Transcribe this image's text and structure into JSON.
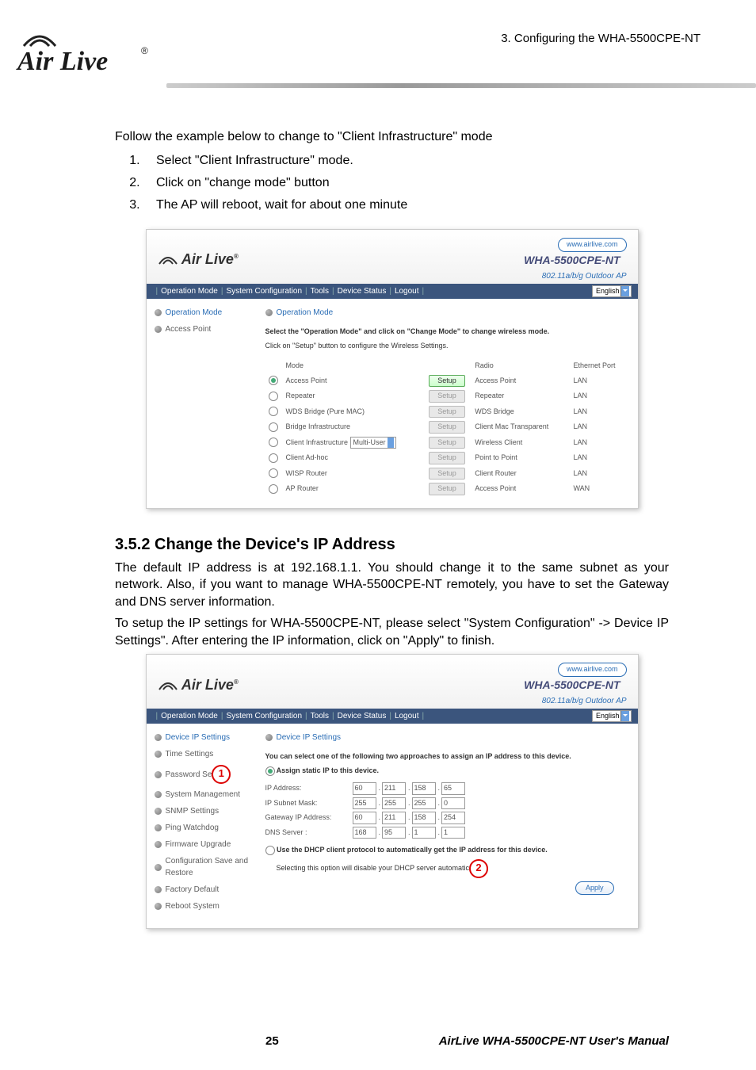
{
  "doc": {
    "chapter_title": "3. Configuring the WHA-5500CPE-NT",
    "brand": "Air Live",
    "intro": "Follow the example below to change to \"Client Infrastructure\" mode",
    "steps": [
      "Select \"Client Infrastructure\" mode.",
      "Click on \"change mode\" button",
      "The AP will reboot, wait for about one minute"
    ],
    "section_heading": "3.5.2 Change the Device's IP Address",
    "ip_para1": "The default IP address is at 192.168.1.1.   You should change it to the same subnet as your network.   Also, if you want to manage WHA-5500CPE-NT remotely, you have to set the Gateway and DNS server information.",
    "ip_para2": "To setup the IP settings for WHA-5500CPE-NT, please select \"System Configuration\" -> Device IP Settings\".   After entering the IP information, click on \"Apply\" to finish.",
    "page_number": "25",
    "footer_right": "AirLive WHA-5500CPE-NT User's Manual"
  },
  "shot1": {
    "url": "www.airlive.com",
    "model": "WHA-5500CPE-NT",
    "subtitle": "802.11a/b/g Outdoor AP",
    "nav": [
      "Operation Mode",
      "System Configuration",
      "Tools",
      "Device Status",
      "Logout"
    ],
    "lang_selected": "English",
    "sidebar": [
      {
        "label": "Operation Mode",
        "active": true
      },
      {
        "label": "Access Point",
        "active": false
      }
    ],
    "panel_title": "Operation Mode",
    "instr_bold": "Select the \"Operation Mode\" and click on \"Change Mode\" to change wireless mode.",
    "instr": "Click on \"Setup\" button to configure the Wireless Settings.",
    "columns": {
      "mode": "Mode",
      "radio": "Radio",
      "port": "Ethernet Port"
    },
    "rows": [
      {
        "checked": true,
        "mode": "Access Point",
        "setup_active": true,
        "radio": "Access Point",
        "port": "LAN",
        "extra": ""
      },
      {
        "checked": false,
        "mode": "Repeater",
        "setup_active": false,
        "radio": "Repeater",
        "port": "LAN",
        "extra": ""
      },
      {
        "checked": false,
        "mode": "WDS Bridge (Pure MAC)",
        "setup_active": false,
        "radio": "WDS Bridge",
        "port": "LAN",
        "extra": ""
      },
      {
        "checked": false,
        "mode": "Bridge Infrastructure",
        "setup_active": false,
        "radio": "Client Mac Transparent",
        "port": "LAN",
        "extra": ""
      },
      {
        "checked": false,
        "mode": "Client Infrastructure",
        "setup_active": false,
        "radio": "Wireless Client",
        "port": "LAN",
        "extra": "Multi-User"
      },
      {
        "checked": false,
        "mode": "Client Ad-hoc",
        "setup_active": false,
        "radio": "Point to Point",
        "port": "LAN",
        "extra": ""
      },
      {
        "checked": false,
        "mode": "WISP Router",
        "setup_active": false,
        "radio": "Client Router",
        "port": "LAN",
        "extra": ""
      },
      {
        "checked": false,
        "mode": "AP Router",
        "setup_active": false,
        "radio": "Access Point",
        "port": "WAN",
        "extra": ""
      }
    ],
    "setup_label": "Setup"
  },
  "shot2": {
    "url": "www.airlive.com",
    "model": "WHA-5500CPE-NT",
    "subtitle": "802.11a/b/g Outdoor AP",
    "nav": [
      "Operation Mode",
      "System Configuration",
      "Tools",
      "Device Status",
      "Logout"
    ],
    "lang_selected": "English",
    "sidebar": [
      "Device IP Settings",
      "Time Settings",
      "Password Setti",
      "System Management",
      "SNMP Settings",
      "Ping Watchdog",
      "Firmware Upgrade",
      "Configuration Save and Restore",
      "Factory Default",
      "Reboot System"
    ],
    "panel_title": "Device IP Settings",
    "intro": "You can select one of the following two approaches to assign an IP address to this device.",
    "opt1_label": "Assign static IP to this device.",
    "fields": {
      "ip_label": "IP Address:",
      "ip": [
        "60",
        "211",
        "158",
        "65"
      ],
      "mask_label": "IP Subnet Mask:",
      "mask": [
        "255",
        "255",
        "255",
        "0"
      ],
      "gw_label": "Gateway IP Address:",
      "gw": [
        "60",
        "211",
        "158",
        "254"
      ],
      "dns_label": "DNS Server :",
      "dns": [
        "168",
        "95",
        "1",
        "1"
      ]
    },
    "opt2_label": "Use the DHCP client protocol to automatically get the IP address for this device.",
    "opt2_note": "Selecting this option will disable your DHCP server automatic",
    "apply": "Apply",
    "callout1": "1",
    "callout2": "2"
  }
}
